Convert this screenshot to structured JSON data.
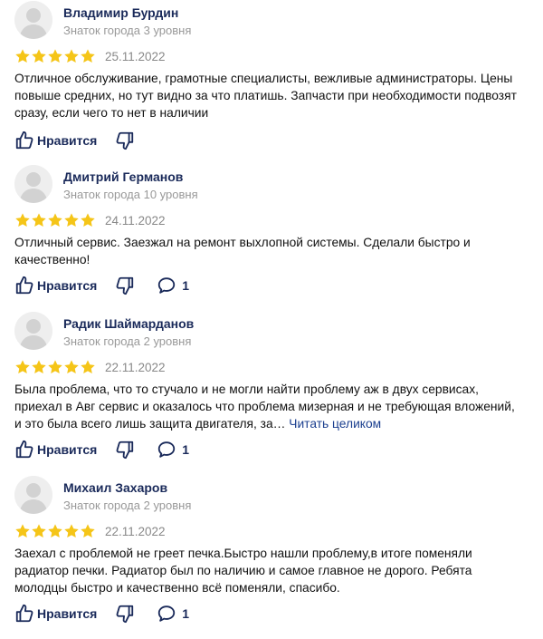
{
  "colors": {
    "accent": "#1a2a5a",
    "star": "#f5c518",
    "muted": "#999999",
    "link": "#1b3f8f"
  },
  "reviews": [
    {
      "name": "Владимир Бурдин",
      "level": "Знаток города 3 уровня",
      "stars": 5,
      "date": "25.11.2022",
      "text": "Отличное обслуживание, грамотные специалисты, вежливые администраторы. Цены повыше средних, но тут видно за что платишь. Запчасти при необходимости подвозят сразу, если чего то нет в наличии",
      "more": "",
      "like_label": "Нравится",
      "comments": ""
    },
    {
      "name": "Дмитрий Германов",
      "level": "Знаток города 10 уровня",
      "stars": 5,
      "date": "24.11.2022",
      "text": "Отличный сервис. Заезжал на ремонт выхлопной системы. Сделали быстро и качественно!",
      "more": "",
      "like_label": "Нравится",
      "comments": "1"
    },
    {
      "name": "Радик Шаймарданов",
      "level": "Знаток города 2 уровня",
      "stars": 5,
      "date": "22.11.2022",
      "text": "Была проблема, что то стучало и не могли найти проблему аж в двух сервисах, приехал в Авг сервис и оказалось что проблема мизерная и не требующая вложений, и это была всего лишь защита двигателя, за…",
      "more": "Читать целиком",
      "like_label": "Нравится",
      "comments": "1"
    },
    {
      "name": "Михаил Захаров",
      "level": "Знаток города 2 уровня",
      "stars": 5,
      "date": "22.11.2022",
      "text": "Заехал с проблемой не греет печка.Быстро нашли проблему,в итоге поменяли радиатор печки. Радиатор был по наличию и самое главное не дорого. Ребята молодцы быстро и качественно всё поменяли, спасибо.",
      "more": "",
      "like_label": "Нравится",
      "comments": "1"
    }
  ]
}
